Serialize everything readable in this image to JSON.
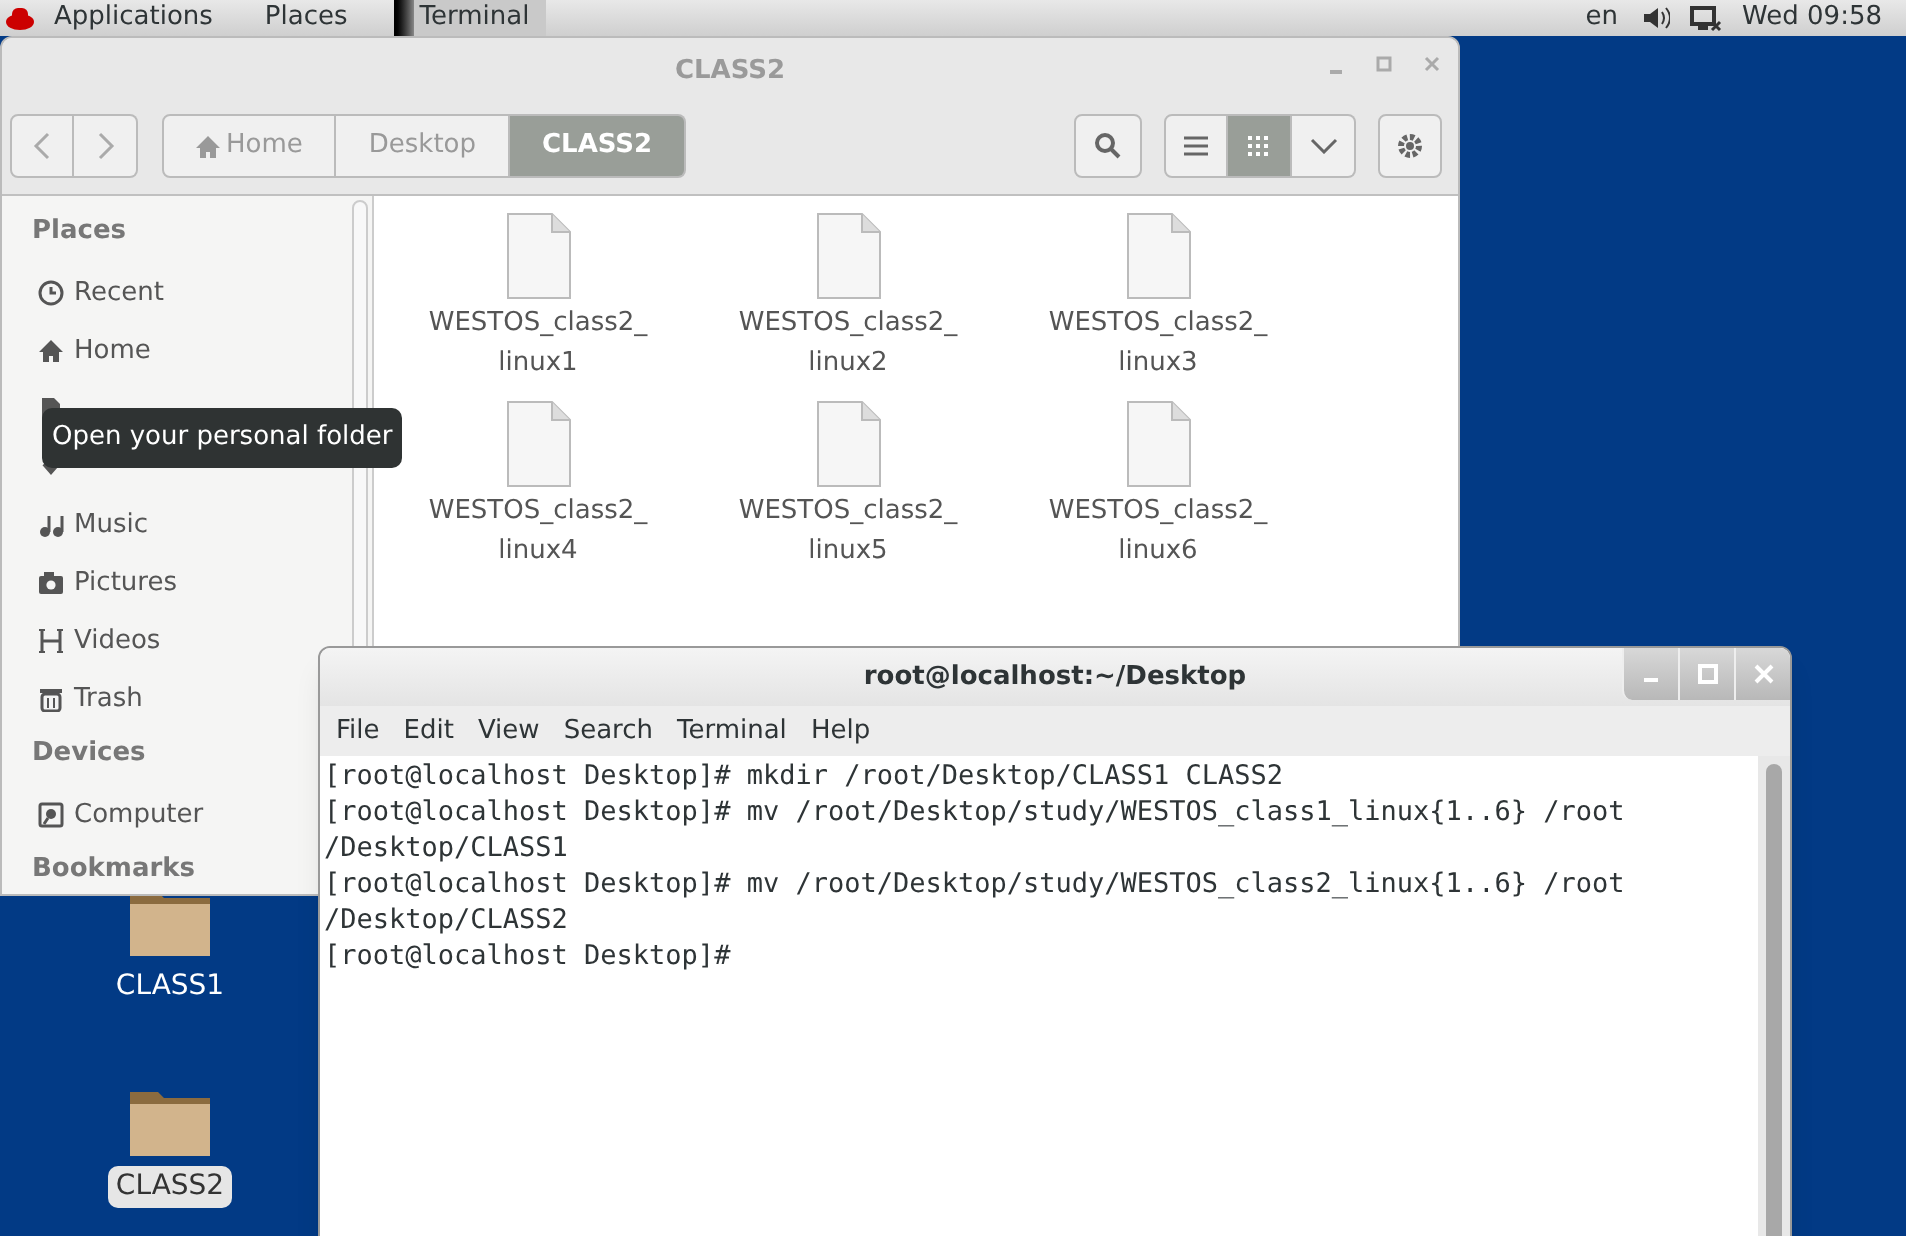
{
  "top_bar": {
    "menus": [
      "Applications",
      "Places"
    ],
    "task": "Terminal",
    "language": "en",
    "clock": "Wed 09:58"
  },
  "files_window": {
    "title": "CLASS2",
    "path": [
      {
        "label": "Home",
        "kind": "home",
        "selected": false
      },
      {
        "label": "Desktop",
        "kind": "plain",
        "selected": false
      },
      {
        "label": "CLASS2",
        "kind": "plain",
        "selected": true
      }
    ],
    "view_modes": [
      {
        "kind": "list",
        "selected": false
      },
      {
        "kind": "grid",
        "selected": true
      }
    ],
    "sidebar": [
      {
        "heading": "Places",
        "items": [
          {
            "label": "Recent",
            "kind": "clock"
          },
          {
            "label": "Home",
            "kind": "home"
          },
          {
            "kind": "doc"
          },
          {
            "kind": "down"
          },
          {
            "label": "Music",
            "kind": "music"
          },
          {
            "label": "Pictures",
            "kind": "camera"
          },
          {
            "label": "Videos",
            "kind": "film"
          },
          {
            "label": "Trash",
            "kind": "trash"
          }
        ]
      },
      {
        "heading": "Devices",
        "items": [
          {
            "label": "Computer",
            "kind": "disk"
          }
        ]
      },
      {
        "heading": "Bookmarks"
      }
    ],
    "tooltip": "Open your personal folder",
    "files": [
      "WESTOS_class2_linux1",
      "WESTOS_class2_linux2",
      "WESTOS_class2_linux3",
      "WESTOS_class2_linux4",
      "WESTOS_class2_linux5",
      "WESTOS_class2_linux6"
    ]
  },
  "terminal_window": {
    "title": "root@localhost:~/Desktop",
    "menu": [
      "File",
      "Edit",
      "View",
      "Search",
      "Terminal",
      "Help"
    ],
    "lines": [
      "[root@localhost Desktop]# mkdir /root/Desktop/CLASS1 CLASS2",
      "[root@localhost Desktop]# mv /root/Desktop/study/WESTOS_class1_linux{1..6} /root",
      "/Desktop/CLASS1",
      "[root@localhost Desktop]# mv /root/Desktop/study/WESTOS_class2_linux{1..6} /root",
      "/Desktop/CLASS2",
      "[root@localhost Desktop]#"
    ]
  },
  "desktop_icons": [
    {
      "label": "CLASS1",
      "selected": false
    },
    {
      "label": "CLASS2",
      "selected": true
    }
  ]
}
